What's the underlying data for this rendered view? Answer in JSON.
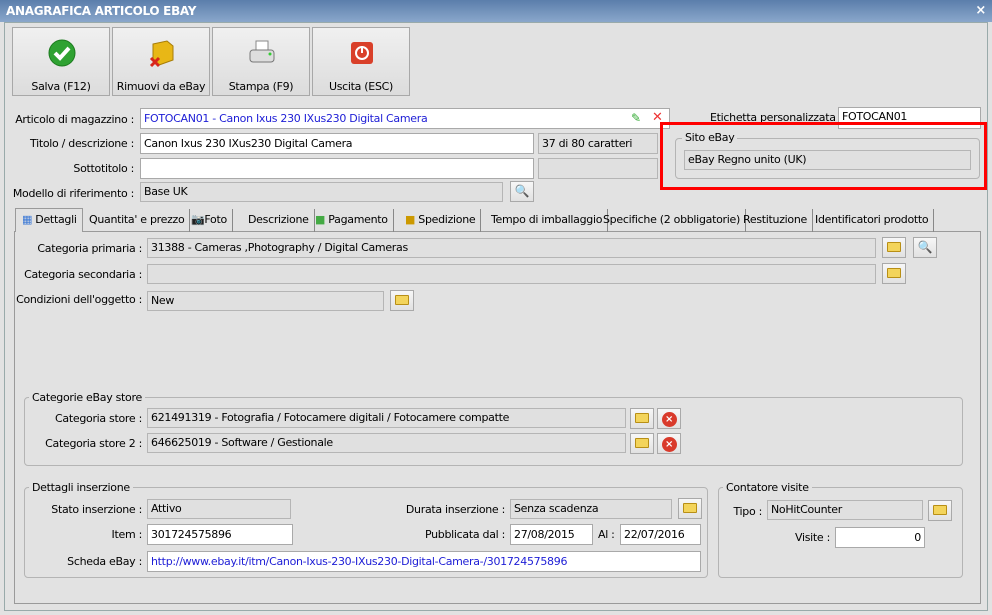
{
  "window": {
    "title": "ANAGRAFICA ARTICOLO EBAY",
    "close": "×"
  },
  "toolbar": [
    {
      "label": "Salva (F12)",
      "icon": "check-icon"
    },
    {
      "label": "Rimuovi da eBay",
      "icon": "box-remove-icon"
    },
    {
      "label": "Stampa (F9)",
      "icon": "printer-icon"
    },
    {
      "label": "Uscita (ESC)",
      "icon": "power-icon"
    }
  ],
  "header": {
    "articolo_label": "Articolo di magazzino :",
    "articolo_value": "FOTOCAN01 - Canon Ixus 230 IXus230 Digital Camera",
    "titolo_label": "Titolo / descrizione :",
    "titolo_value": "Canon Ixus 230 IXus230 Digital Camera",
    "char_count": "37 di 80 caratteri",
    "sottotitolo_label": "Sottotitolo :",
    "sottotitolo_value": "",
    "modello_label": "Modello di riferimento :",
    "modello_value": "Base UK",
    "etichetta_label": "Etichetta personalizzata :",
    "etichetta_value": "FOTOCAN01",
    "sito_legend": "Sito eBay",
    "sito_value": "eBay Regno unito (UK)",
    "highlight_color": "#ff0000"
  },
  "tabs": [
    "Dettagli",
    "Quantita' e prezzo",
    "Foto",
    "Descrizione",
    "Pagamento",
    "Spedizione",
    "Tempo di imballaggio",
    "Specifiche (2 obbligatorie)",
    "Restituzione",
    "Identificatori prodotto"
  ],
  "dettagli": {
    "cat_primaria_label": "Categoria primaria :",
    "cat_primaria_value": "31388 - Cameras ,Photography / Digital Cameras",
    "cat_secondaria_label": "Categoria secondaria :",
    "cat_secondaria_value": "",
    "condizioni_label": "Condizioni dell'oggetto :",
    "condizioni_value": "New",
    "store_legend": "Categorie eBay store",
    "store1_label": "Categoria store :",
    "store1_value": "621491319 - Fotografia / Fotocamere digitali / Fotocamere compatte",
    "store2_label": "Categoria store 2 :",
    "store2_value": "646625019 - Software / Gestionale",
    "ins_legend": "Dettagli inserzione",
    "stato_label": "Stato inserzione :",
    "stato_value": "Attivo",
    "item_label": "Item :",
    "item_value": "301724575896",
    "scheda_label": "Scheda eBay :",
    "scheda_value": "http://www.ebay.it/itm/Canon-Ixus-230-IXus230-Digital-Camera-/301724575896",
    "durata_label": "Durata inserzione :",
    "durata_value": "Senza scadenza",
    "pubblicata_label": "Pubblicata dal :",
    "pubblicata_value": "27/08/2015",
    "al_label": "Al :",
    "al_value": "22/07/2016",
    "contatore_legend": "Contatore visite",
    "tipo_label": "Tipo :",
    "tipo_value": "NoHitCounter",
    "visite_label": "Visite :",
    "visite_value": "0"
  }
}
